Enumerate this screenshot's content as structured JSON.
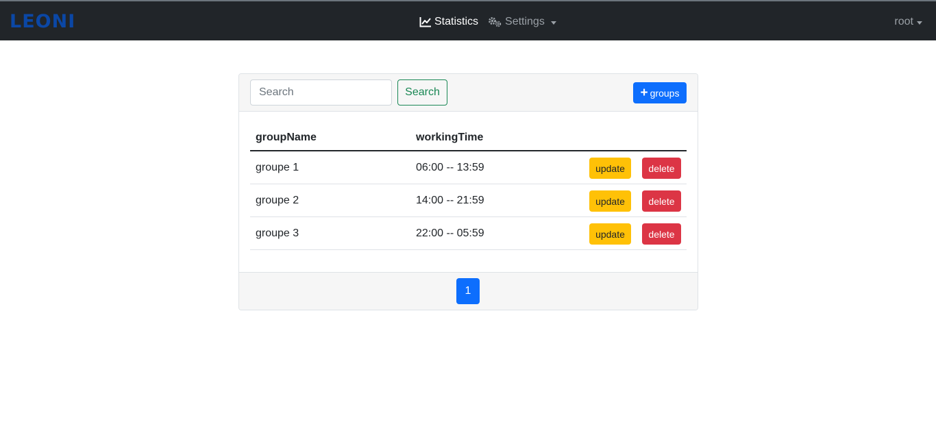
{
  "navbar": {
    "brand": "LEONI",
    "statistics_label": "Statistics",
    "settings_label": "Settings",
    "user_label": "root",
    "icons": {
      "statistics": "line-chart-icon",
      "settings": "cogs-icon"
    }
  },
  "toolbar": {
    "search_placeholder": "Search",
    "search_button": "Search",
    "add_button": "groups"
  },
  "table": {
    "headers": [
      "groupName",
      "workingTime"
    ],
    "rows": [
      {
        "groupName": "groupe 1",
        "workingTime": "06:00 -- 13:59"
      },
      {
        "groupName": "groupe 2",
        "workingTime": "14:00 -- 21:59"
      },
      {
        "groupName": "groupe 3",
        "workingTime": "22:00 -- 05:59"
      }
    ],
    "update_label": "update",
    "delete_label": "delete"
  },
  "pagination": {
    "current_page": "1"
  },
  "colors": {
    "navbar_bg": "#212529",
    "brand": "#0b47a5",
    "primary": "#0d6efd",
    "success": "#198754",
    "warning": "#ffc107",
    "danger": "#dc3545"
  }
}
